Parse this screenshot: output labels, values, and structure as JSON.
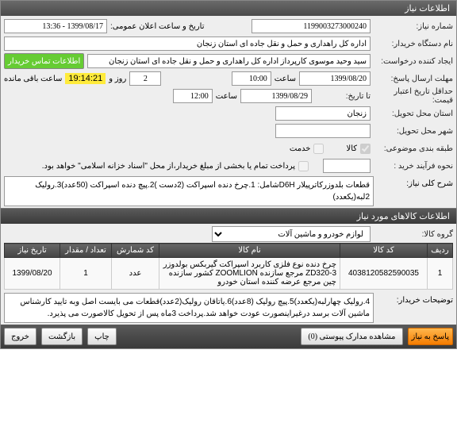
{
  "titlebar": "اطلاعات نیاز",
  "labels": {
    "need_no": "شماره نیاز:",
    "public_announce": "تاریخ و ساعت اعلان عمومی:",
    "org_name": "نام دستگاه خریدار:",
    "buyer_contact_btn": "اطلاعات تماس خریدار",
    "creator": "ایجاد کننده درخواست:",
    "reply_deadline": "مهلت ارسال پاسخ:",
    "hour": "ساعت",
    "day_and": "روز و",
    "time_left": "ساعت باقی مانده",
    "min_validity": "حداقل تاریخ اعتبار قیمت:",
    "to_date": "تا تاریخ:",
    "delivery_province": "استان محل تحویل:",
    "delivery_city": "شهر محل تحویل:",
    "classification": "طبقه بندی موضوعی:",
    "goods": "کالا",
    "service": "خدمت",
    "procurement": "نحوه فرآیند خرید :",
    "prepay_note": "پرداخت تمام یا بخشی از مبلغ خریدار،از محل \"اسناد خزانه اسلامی\" خواهد بود.",
    "need_desc": "شرح کلی نیاز:",
    "goods_section": "اطلاعات کالاهای مورد نیاز",
    "goods_group": "گروه کالا:",
    "buyer_notes": "توضیحات خریدار:",
    "reply_btn": "پاسخ به نیاز",
    "attachments_btn": "مشاهده مدارک پیوستی  (0)",
    "print_btn": "چاپ",
    "back_btn": "بازگشت",
    "exit_btn": "خروج"
  },
  "values": {
    "need_no": "1199003273000240",
    "public_announce": "1399/08/17 - 13:36",
    "org_name": "اداره کل راهداری و حمل و نقل جاده ای استان زنجان",
    "creator": "سید وحید موسوی کارپرداز اداره کل راهداری و حمل و نقل جاده ای استان زنجان",
    "reply_date": "1399/08/20",
    "reply_time": "10:00",
    "days_left": "2",
    "time_left": "19:14:21",
    "validity_date": "1399/08/29",
    "validity_time": "12:00",
    "delivery_province": "زنجان",
    "delivery_city": "",
    "goods_chk": true,
    "service_chk": false,
    "procurement": "",
    "prepay_chk": false,
    "need_desc": "قطعات بلدوزرکاترپیلار D6Hشامل: 1.چرخ دنده اسپراکت (2دست )2.پیچ دنده اسپراکت (50عدد)3.رولیک 2لبه(یکعدد)",
    "goods_group": "لوازم خودرو و ماشین آلات",
    "buyer_notes": "4.رولیک چهارلبه(یکعدد)5.پیچ رولیک (8عدد)6.یاتاقان رولیک(2عدد)قطعات می بایست اصل وبه تایید کارشناس ماشین آلات برسد درغیراینصورت عودت خواهد شد.پرداخت 3ماه پس از تحویل کالاصورت می پذیرد."
  },
  "table": {
    "headers": [
      "ردیف",
      "کد کالا",
      "نام کالا",
      "کد شمارش",
      "تعداد / مقدار",
      "تاریخ نیاز"
    ],
    "rows": [
      {
        "idx": "1",
        "code": "4038120582590035",
        "name": "چرخ دنده نوع فلزی کاربرد اسپراکت گیربکس بولدوزر ZD320-3 مرجع سازنده ZOOMLION کشور سازنده چین مرجع عرضه کننده استان خودرو",
        "unit": "عدد",
        "qty": "1",
        "date": "1399/08/20"
      }
    ]
  }
}
